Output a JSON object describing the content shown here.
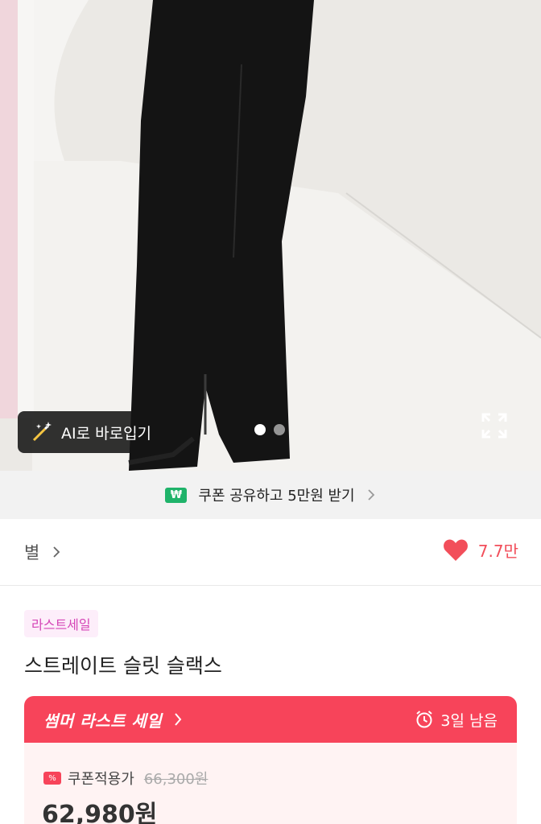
{
  "hero": {
    "ai_button_label": "AI로 바로입기",
    "ai_icon": "magic-wand-icon",
    "expand_icon": "expand-icon"
  },
  "coupon_bar": {
    "icon_text": "₩",
    "text": "쿠폰 공유하고 5만원 받기"
  },
  "store": {
    "name": "별",
    "like_count": "7.7만"
  },
  "product": {
    "tag": "라스트세일",
    "title": "스트레이트 슬릿 슬랙스"
  },
  "sale": {
    "title": "썸머 라스트 세일",
    "remaining": "3일 남음",
    "price_label": "쿠폰적용가",
    "original_price": "66,300원",
    "final_price": "62,980원",
    "coupon_icon_text": "%"
  },
  "colors": {
    "sale_red": "#f7445a",
    "heart_red": "#f24e5a",
    "coupon_green": "#1fb36a",
    "tag_pink": "#d546b7"
  }
}
